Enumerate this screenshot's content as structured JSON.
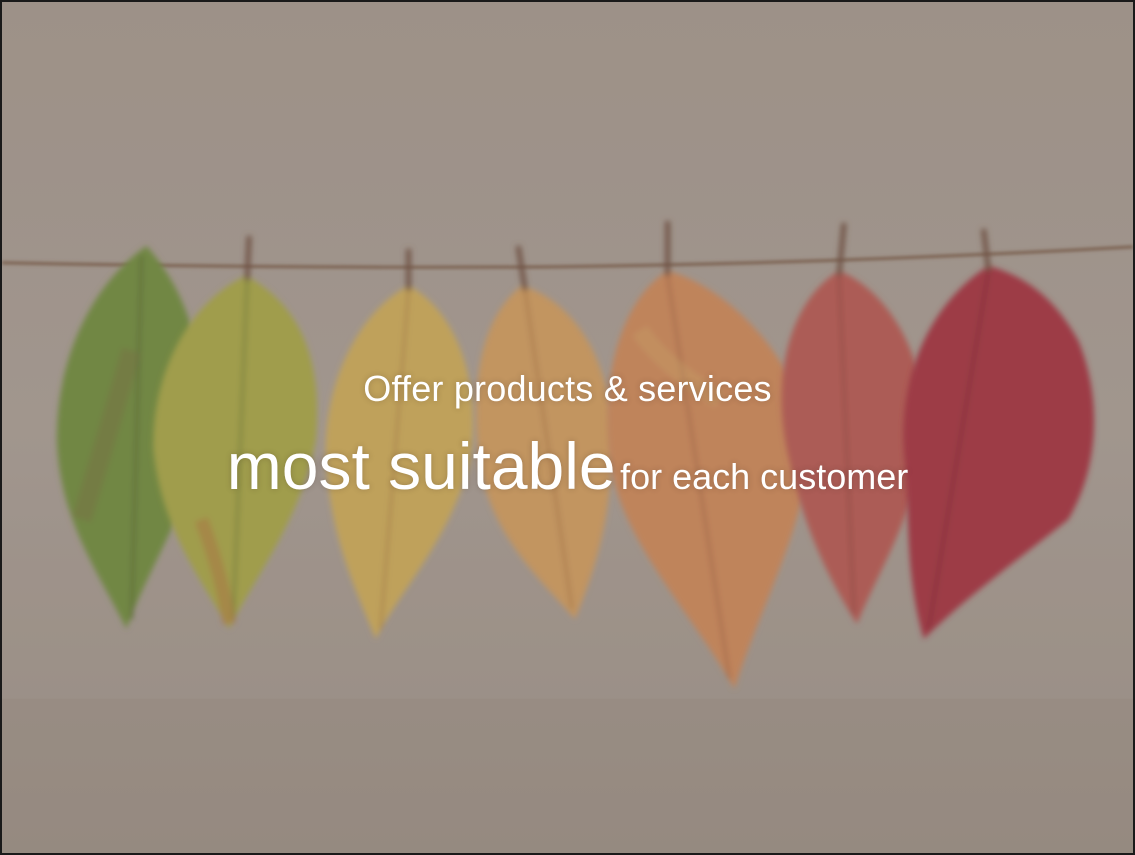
{
  "slide": {
    "headline_line1": "Offer products & services",
    "headline_emphasis": "most suitable",
    "headline_rest": "for each customer",
    "background": {
      "description_icon": "autumn-leaves-on-string-photo",
      "colors": {
        "wall": "#a89d93",
        "string": "#7a5e4c",
        "leaf_green": "#6f8e3e",
        "leaf_yellow_green": "#a9a947",
        "leaf_yellow": "#cfae5a",
        "leaf_orange_yellow": "#d29f60",
        "leaf_orange": "#cf8a5a",
        "leaf_red_orange": "#b85a52",
        "leaf_red": "#a5333f"
      }
    },
    "text_color": "#ffffff"
  }
}
